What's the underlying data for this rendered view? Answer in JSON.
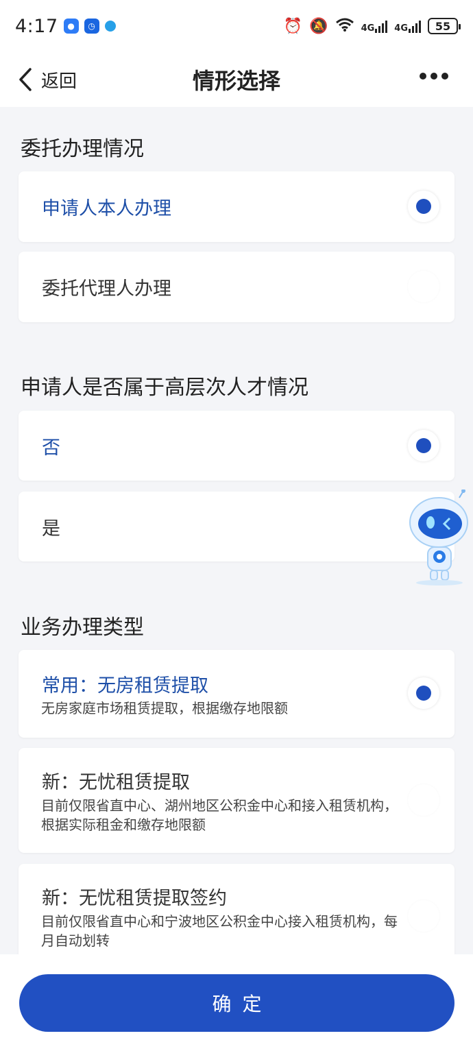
{
  "status_bar": {
    "time": "4:17",
    "network_1": "4G",
    "network_2": "4G",
    "battery": "55"
  },
  "nav": {
    "back_label": "返回",
    "title": "情形选择"
  },
  "sections": [
    {
      "title": "委托办理情况",
      "options": [
        {
          "label": "申请人本人办理",
          "selected": true
        },
        {
          "label": "委托代理人办理",
          "selected": false
        }
      ]
    },
    {
      "title": "申请人是否属于高层次人才情况",
      "options": [
        {
          "label": "否",
          "selected": true
        },
        {
          "label": "是",
          "selected": false
        }
      ]
    },
    {
      "title": "业务办理类型",
      "options": [
        {
          "label": "常用：无房租赁提取",
          "desc": "无房家庭市场租赁提取，根据缴存地限额",
          "selected": true
        },
        {
          "label": "新：无忧租赁提取",
          "desc": "目前仅限省直中心、湖州地区公积金中心和接入租赁机构，根据实际租金和缴存地限额",
          "selected": false
        },
        {
          "label": "新：无忧租赁提取签约",
          "desc": "目前仅限省直中心和宁波地区公积金中心接入租赁机构，每月自动划转",
          "selected": false
        }
      ]
    }
  ],
  "confirm_label": "确定",
  "colors": {
    "accent": "#2150c2",
    "selected_text": "#1e4fa8",
    "background": "#f4f5f8"
  },
  "icons": [
    "back-chevron-icon",
    "more-dots-icon",
    "radio-icon",
    "robot-assistant-icon",
    "alarm-icon",
    "mute-bell-icon",
    "wifi-icon"
  ]
}
